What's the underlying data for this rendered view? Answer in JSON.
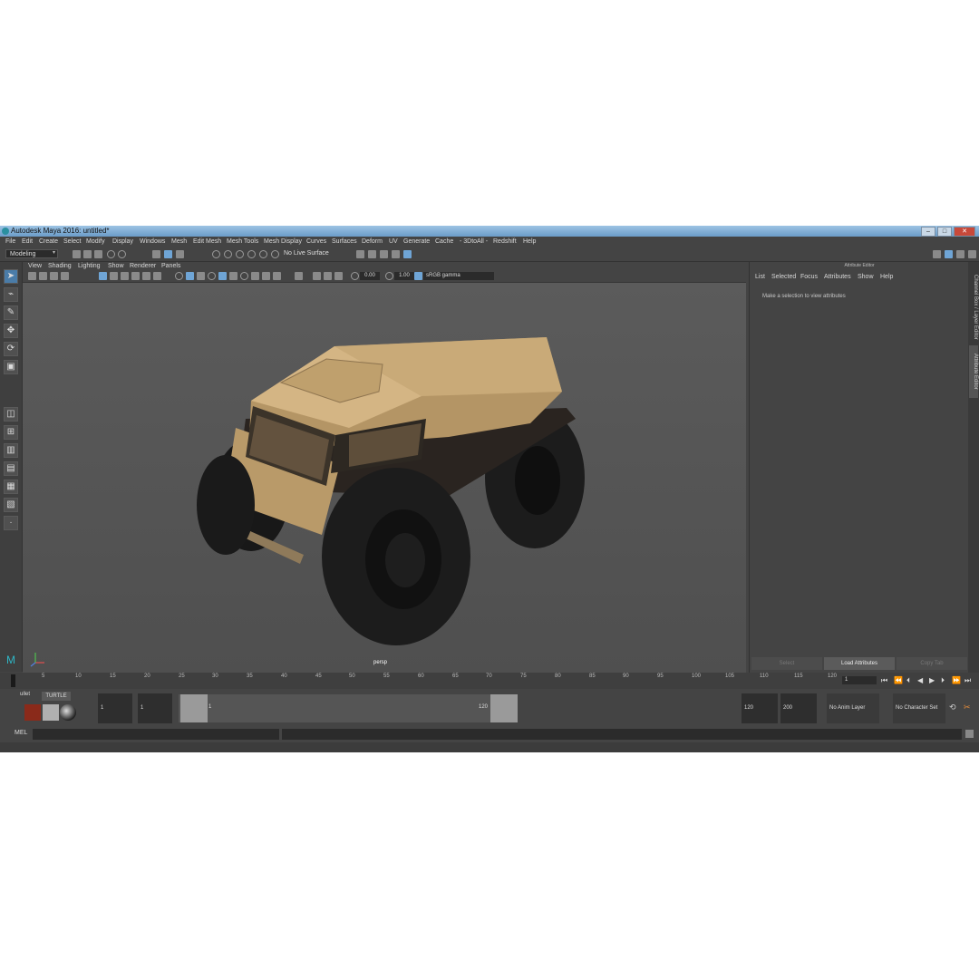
{
  "titlebar": {
    "title": "Autodesk Maya 2016: untitled*",
    "min": "–",
    "max": "□",
    "close": "✕"
  },
  "menubar": {
    "items": [
      "File",
      "Edit",
      "Create",
      "Select",
      "Modify",
      "Display",
      "Windows",
      "Mesh",
      "Edit Mesh",
      "Mesh Tools",
      "Mesh Display",
      "Curves",
      "Surfaces",
      "Deform",
      "UV",
      "Generate",
      "Cache",
      "- 3DtoAll -",
      "Redshift",
      "Help"
    ]
  },
  "shelf": {
    "mode": "Modeling",
    "live_surface": "No Live Surface"
  },
  "viewport": {
    "menu": [
      "View",
      "Shading",
      "Lighting",
      "Show",
      "Renderer",
      "Panels"
    ],
    "exposure": "0.00",
    "gamma_value": "1.00",
    "color_space": "sRGB gamma",
    "camera": "persp"
  },
  "attribute_editor": {
    "title": "Attribute Editor",
    "menu": [
      "List",
      "Selected",
      "Focus",
      "Attributes",
      "Show",
      "Help"
    ],
    "message": "Make a selection to view attributes",
    "buttons": [
      "Select",
      "Load Attributes",
      "Copy Tab"
    ]
  },
  "side_tabs": [
    "Channel Box / Layer Editor",
    "Attribute Editor"
  ],
  "timeline": {
    "ticks": [
      "1",
      "5",
      "10",
      "15",
      "20",
      "25",
      "30",
      "35",
      "40",
      "45",
      "50",
      "55",
      "60",
      "65",
      "70",
      "75",
      "80",
      "85",
      "90",
      "95",
      "100",
      "105",
      "110",
      "115",
      "120"
    ],
    "current_frame": "1"
  },
  "range": {
    "tab_label": "ullet",
    "turtle": "TURTLE",
    "start_anim": "1",
    "start": "1",
    "slider_start": "1",
    "slider_end": "120",
    "end": "120",
    "end_anim": "200",
    "anim_layer": "No Anim Layer",
    "char_set": "No Character Set"
  },
  "command": {
    "label": "MEL"
  },
  "colors": {
    "accent": "#4a7ca8",
    "vehicle": "#c9aa78",
    "tire": "#1e1e1e"
  }
}
